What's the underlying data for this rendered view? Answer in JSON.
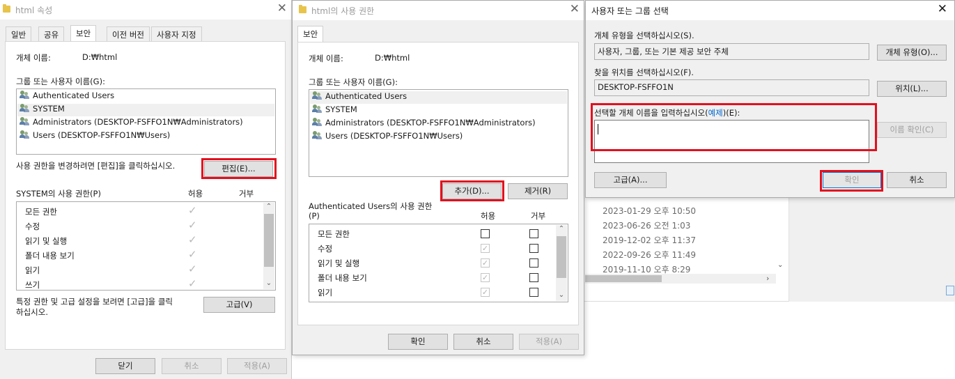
{
  "win1": {
    "title": "html 속성",
    "tabs": [
      "일반",
      "공유",
      "보안",
      "이전 버전",
      "사용자 지정"
    ],
    "object_name_label": "개체 이름:",
    "object_name_value": "D:₩html",
    "groups_label": "그룹 또는 사용자 이름(G):",
    "users": [
      "Authenticated Users",
      "SYSTEM",
      "Administrators (DESKTOP-FSFFO1N₩Administrators)",
      "Users (DESKTOP-FSFFO1N₩Users)"
    ],
    "edit_hint": "사용 권한을 변경하려면 [편집]을 클릭하십시오.",
    "edit_button": "편집(E)...",
    "perm_header": "SYSTEM의 사용 권한(P)",
    "allow_label": "허용",
    "deny_label": "거부",
    "permissions": [
      "모든 권한",
      "수정",
      "읽기 및 실행",
      "폴더 내용 보기",
      "읽기",
      "쓰기"
    ],
    "advanced_hint_1": "특정 권한 및 고급 설정을 보려면 [고급]을 클릭",
    "advanced_hint_2": "하십시오.",
    "advanced_button": "고급(V)",
    "close_button": "닫기",
    "cancel_button": "취소",
    "apply_button": "적용(A)"
  },
  "win2": {
    "title": "html의 사용 권한",
    "tab": "보안",
    "object_name_label": "개체 이름:",
    "object_name_value": "D:₩html",
    "groups_label": "그룹 또는 사용자 이름(G):",
    "users": [
      "Authenticated Users",
      "SYSTEM",
      "Administrators (DESKTOP-FSFFO1N₩Administrators)",
      "Users (DESKTOP-FSFFO1N₩Users)"
    ],
    "add_button": "추가(D)...",
    "remove_button": "제거(R)",
    "perm_header_1": "Authenticated Users의 사용 권한",
    "perm_header_2": "(P)",
    "allow_label": "허용",
    "deny_label": "거부",
    "permissions": [
      "모든 권한",
      "수정",
      "읽기 및 실행",
      "폴더 내용 보기",
      "읽기"
    ],
    "ok_button": "확인",
    "cancel_button": "취소",
    "apply_button": "적용(A)"
  },
  "win3": {
    "title": "사용자 또는 그룹 선택",
    "object_type_label": "개체 유형을 선택하십시오(S).",
    "object_type_value": "사용자, 그룹, 또는 기본 제공 보안 주체",
    "object_type_button": "개체 유형(O)...",
    "location_label": "찾을 위치를 선택하십시오(F).",
    "location_value": "DESKTOP-FSFFO1N",
    "location_button": "위치(L)...",
    "enter_label_pre": "선택할 개체 이름을 입력하십시오(",
    "enter_label_link": "예제",
    "enter_label_post": ")(E):",
    "names_input_value": "",
    "check_names_button": "이름 확인(C)",
    "advanced_button": "고급(A)...",
    "ok_button": "확인",
    "cancel_button": "취소"
  },
  "background": {
    "dates": [
      "2023-01-29 오후 10:50",
      "2023-06-26 오전 1:03",
      "2019-12-02 오후 11:37",
      "2022-09-26 오후 11:49",
      "2019-11-10 오후 8:29"
    ]
  }
}
